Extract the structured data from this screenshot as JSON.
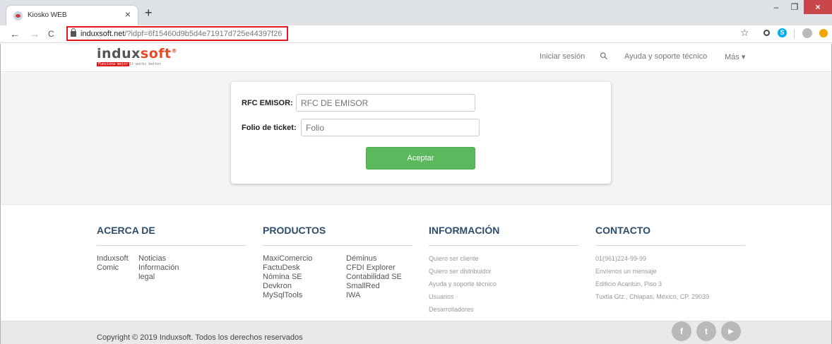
{
  "browser": {
    "tab_title": "Kiosko WEB",
    "tab_close": "×",
    "new_tab": "+",
    "url_host": "induxsoft.net",
    "url_path": "/?idpf=6f15460d9b5d4e71917d725e44397f26",
    "back": "←",
    "forward": "→",
    "reload": "C",
    "star": "☆",
    "minimize": "–",
    "maximize": "❐",
    "close": "×"
  },
  "header": {
    "logo_part1": "indux",
    "logo_part2": "soft",
    "logo_reg": "®",
    "tagline_red": "Funciona mejor",
    "tagline_grey": "It works better",
    "nav": {
      "login": "Iniciar sesión",
      "search_icon": "⚲",
      "help": "Ayuda y soporte técnico",
      "more": "Más ▾"
    }
  },
  "form": {
    "rfc_label": "RFC EMISOR:",
    "rfc_placeholder": "RFC DE EMISOR",
    "folio_label": "Folio de ticket:",
    "folio_placeholder": "Folio",
    "accept_label": "Aceptar"
  },
  "footer": {
    "about": {
      "title": "ACERCA DE",
      "col1": [
        "Induxsoft",
        "Comic"
      ],
      "col2": [
        "Noticias",
        "Información",
        "legal"
      ]
    },
    "products": {
      "title": "PRODUCTOS",
      "col1": [
        "MaxiComercio",
        "FactuDesk",
        "Nómina SE",
        "Devkron",
        "MySqlTools"
      ],
      "col2": [
        "Déminus",
        "CFDI Explorer",
        "Contabilidad SE",
        "SmallRed",
        "IWA"
      ]
    },
    "info": {
      "title": "INFORMACIÓN",
      "items": [
        "Quiero ser cliente",
        "Quiero ser distribuidor",
        "Ayuda y soporte técnico",
        "Usuarios",
        "Desarrolladores"
      ]
    },
    "contact": {
      "title": "CONTACTO",
      "items": [
        "01(961)224-99-99",
        "Envíenos un mensaje",
        "Edificio Acantún, Piso 3",
        "Tuxtla Gtz., Chiapas, México, CP. 29039"
      ]
    },
    "copyright": "Copyright © 2019 Induxsoft. Todos los derechos reservados",
    "social": {
      "facebook": "f",
      "twitter": "t",
      "youtube": "▶"
    }
  },
  "colors": {
    "accent_green": "#5cb85c",
    "heading_blue": "#2b4c6b",
    "highlight_red": "#e0191c",
    "logo_orange": "#e64a26"
  }
}
